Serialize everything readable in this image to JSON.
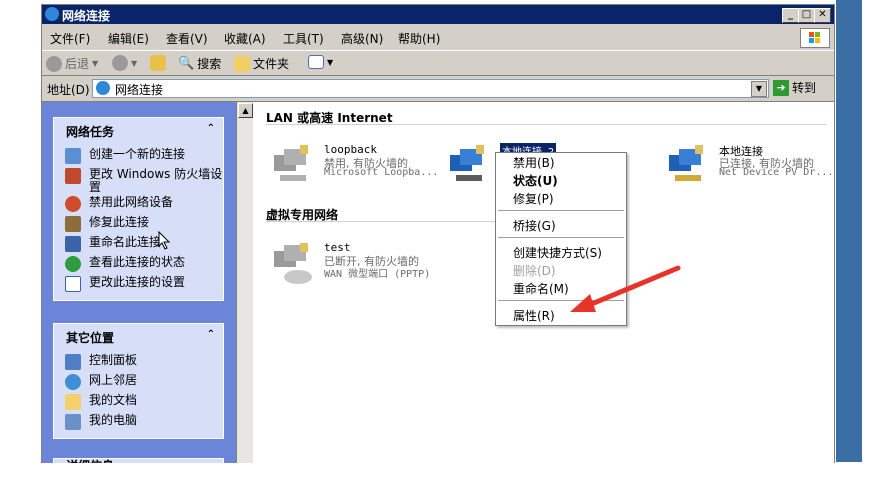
{
  "window": {
    "title": "网络连接"
  },
  "menu": [
    "文件(F)",
    "编辑(E)",
    "查看(V)",
    "收藏(A)",
    "工具(T)",
    "高级(N)",
    "帮助(H)"
  ],
  "toolbar": {
    "back": "后退",
    "search": "搜索",
    "folders": "文件夹"
  },
  "address": {
    "label": "地址(D)",
    "value": "网络连接",
    "go": "转到"
  },
  "network_tasks": {
    "title": "网络任务",
    "items": [
      "创建一个新的连接",
      "更改 Windows 防火墙设置",
      "禁用此网络设备",
      "修复此连接",
      "重命名此连接",
      "查看此连接的状态",
      "更改此连接的设置"
    ]
  },
  "other_places": {
    "title": "其它位置",
    "items": [
      "控制面板",
      "网上邻居",
      "我的文档",
      "我的电脑"
    ]
  },
  "details": {
    "title": "详细信息"
  },
  "sections": {
    "lan": "LAN 或高速 Internet",
    "vpn": "虚拟专用网络"
  },
  "connections": [
    {
      "name": "loopback",
      "status": "禁用, 有防火墙的",
      "device": "Microsoft Loopba..."
    },
    {
      "name": "本地连接 2",
      "status": "",
      "device": ""
    },
    {
      "name": "本地连接",
      "status": "已连接, 有防火墙的",
      "device": "Net Device PV Dr..."
    },
    {
      "name": "test",
      "status": "已断开, 有防火墙的",
      "device": "WAN 微型端口 (PPTP)"
    }
  ],
  "context_menu": [
    "禁用(B)",
    "状态(U)",
    "修复(P)",
    "桥接(G)",
    "创建快捷方式(S)",
    "删除(D)",
    "重命名(M)",
    "属性(R)"
  ],
  "colors": {
    "titlebar": "#0a246a",
    "taskpane": "#6b86d9",
    "arrow": "#e8332b"
  }
}
